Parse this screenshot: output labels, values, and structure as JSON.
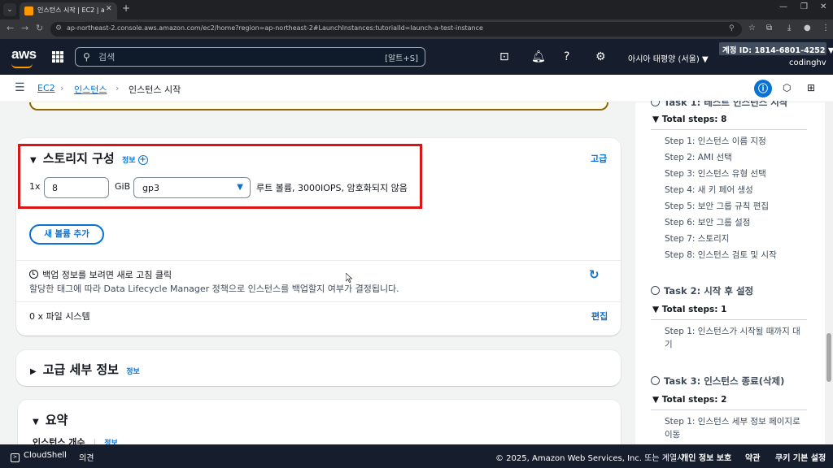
{
  "browser": {
    "tab_title": "인스턴스 시작 | EC2 | ap-north",
    "url": "ap-northeast-2.console.aws.amazon.com/ec2/home?region=ap-northeast-2#LaunchInstances:tutorialId=launch-a-test-instance"
  },
  "header": {
    "logo": "aws",
    "search_placeholder": "검색",
    "search_shortcut": "[알트+S]",
    "region": "아시아 태평양 (서울) ▼",
    "account": "계정 ID: 1814-6801-4252 ▼",
    "username": "codinghv"
  },
  "breadcrumb": {
    "ec2": "EC2",
    "instances": "인스턴스",
    "current": "인스턴스 시작"
  },
  "storage": {
    "title": "스토리지 구성",
    "info": "정보",
    "advanced": "고급",
    "multiplier": "1x",
    "size_value": "8",
    "unit": "GiB",
    "volume_type": "gp3",
    "description": "루트 볼륨,  3000IOPS,  암호화되지 않음",
    "add_volume": "새 볼륨 추가",
    "backup_title": "백업 정보를 보려면 새로 고침 클릭",
    "backup_desc": "할당한 태그에 따라 Data Lifecycle Manager 정책으로 인스턴스를 백업할지 여부가 결정됩니다.",
    "filesystems": "0 x 파일 시스템",
    "edit": "편집"
  },
  "advanced_details": {
    "title": "고급 세부 정보",
    "info": "정보"
  },
  "summary": {
    "title": "요약",
    "instance_count": "인스턴스 개수",
    "info": "정보"
  },
  "tutorial": {
    "partial_title": "Task 1: 테스트 인스턴스 시작",
    "task1_steps": "Total steps: 8",
    "task1_items": [
      "Step 1: 인스턴스 이름 지정",
      "Step 2: AMI 선택",
      "Step 3: 인스턴스 유형 선택",
      "Step 4: 새 키 페어 생성",
      "Step 5: 보안 그룹 규칙 편집",
      "Step 6: 보안 그룹 설정",
      "Step 7: 스토리지",
      "Step 8: 인스턴스 검토 및 시작"
    ],
    "task2_title": "Task 2: 시작 후 설정",
    "task2_steps": "Total steps: 1",
    "task2_item_line1": "Step 1: 인스턴스가 시작될 때까지 대",
    "task2_item_line2": "기",
    "task3_title": "Task 3: 인스턴스 종료(삭제)",
    "task3_steps": "Total steps: 2",
    "task3_item_line1": "Step 1: 인스턴스 세부 정보 페이지로",
    "task3_item_line2": "이동"
  },
  "footer": {
    "cloudshell": "CloudShell",
    "feedback": "의견",
    "copyright": "© 2025, Amazon Web Services, Inc. 또는 계열사.",
    "privacy": "개인 정보 보호",
    "terms": "약관",
    "cookies": "쿠키 기본 설정"
  },
  "colors": {
    "accent": "#0972d3",
    "aws_orange": "#ff9900",
    "header_bg": "#161e2d",
    "highlight_red": "#d91515"
  }
}
